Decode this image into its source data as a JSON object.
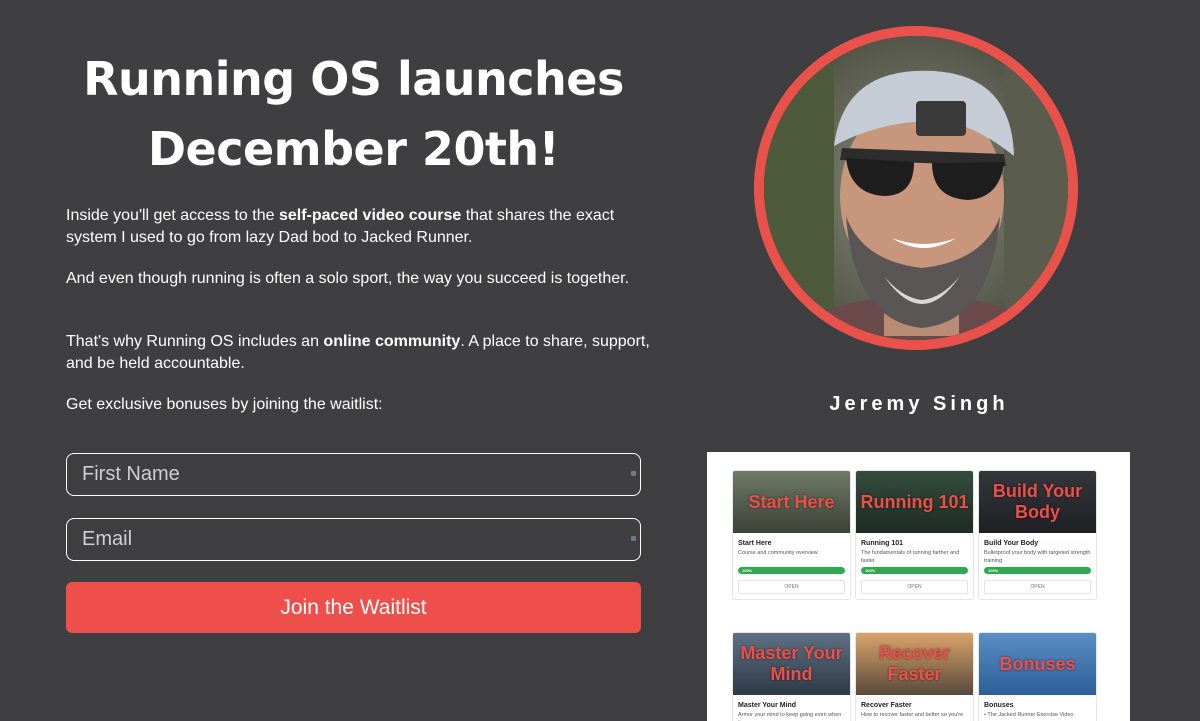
{
  "headline": {
    "line1": "Running OS launches",
    "line2": "December 20th!"
  },
  "intro": {
    "p1_a": "Inside you'll get access to the ",
    "p1_b": "self-paced video course",
    "p1_c": " that shares the exact system I used to go from lazy Dad bod to Jacked Runner.",
    "p2": "And even though running is often a solo sport, the way you succeed is together.",
    "p3_a": "That's why Running OS includes an ",
    "p3_b": "online community",
    "p3_c": ". A place to share, support, and be held accountable.",
    "p4": "Get exclusive bonuses by joining the waitlist:"
  },
  "form": {
    "first_name_placeholder": "First Name",
    "email_placeholder": "Email",
    "submit_label": "Join the Waitlist"
  },
  "profile": {
    "name": "Jeremy Singh"
  },
  "courses": [
    {
      "thumb": "Start Here",
      "title": "Start Here",
      "desc": "Course and community overview",
      "progress": "100%",
      "open": "OPEN"
    },
    {
      "thumb": "Running 101",
      "title": "Running 101",
      "desc": "The fundamentals of running farther and faster",
      "progress": "100%",
      "open": "OPEN"
    },
    {
      "thumb": "Build Your Body",
      "title": "Build Your Body",
      "desc": "Bulletproof your body with targeted strength training",
      "progress": "100%",
      "open": "OPEN"
    },
    {
      "thumb": "Master Your Mind",
      "title": "Master Your Mind",
      "desc": "Armor your mind to keep going even when it",
      "progress": "",
      "open": ""
    },
    {
      "thumb": "Recover Faster",
      "title": "Recover Faster",
      "desc": "How to recover faster and better so you're",
      "progress": "",
      "open": ""
    },
    {
      "thumb": "Bonuses",
      "title": "Bonuses",
      "desc": "• The Jacked Runner Exercise Video",
      "progress": "",
      "open": ""
    }
  ],
  "colors": {
    "background": "#3f3f41",
    "accent": "#ee4f4a",
    "progress": "#2fa84f"
  }
}
